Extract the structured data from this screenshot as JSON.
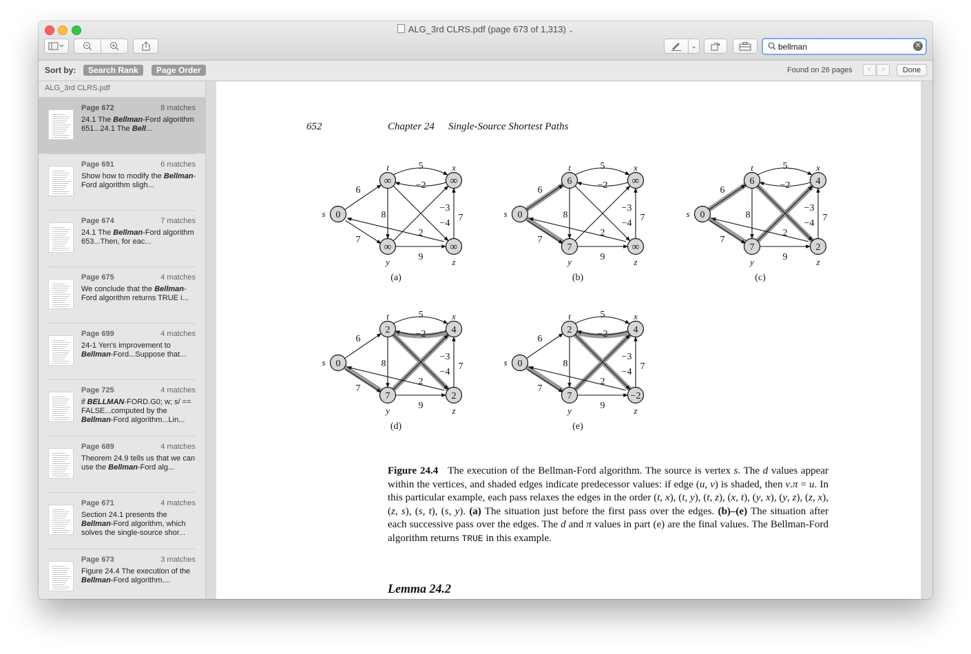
{
  "window": {
    "title": "ALG_3rd CLRS.pdf (page 673 of 1,313)",
    "search_value": "bellman"
  },
  "sortbar": {
    "label": "Sort by:",
    "search_rank": "Search Rank",
    "page_order": "Page Order",
    "found": "Found on 26 pages",
    "done": "Done"
  },
  "sidebar": {
    "filename": "ALG_3rd CLRS.pdf",
    "results": [
      {
        "page": "Page 672",
        "matches": "8 matches",
        "snippet_html": "24.1 The <b><i>Bellman</i></b>-Ford algorithm 651...24.1 The <b><i>Bell</i></b>..."
      },
      {
        "page": "Page 691",
        "matches": "6 matches",
        "snippet_html": "Show how to modify the <b><i>Bellman</i></b>-Ford algorithm sligh..."
      },
      {
        "page": "Page 674",
        "matches": "7 matches",
        "snippet_html": "24.1 The <b><i>Bellman</i></b>-Ford algorithm 653...Then, for eac..."
      },
      {
        "page": "Page 675",
        "matches": "4 matches",
        "snippet_html": "We conclude that the <b><i>Bellman</i></b>-Ford algorithm returns TRUE i..."
      },
      {
        "page": "Page 699",
        "matches": "4 matches",
        "snippet_html": "24-1 Yen's improvement to <b><i>Bellman</i></b>-Ford...Suppose that..."
      },
      {
        "page": "Page 725",
        "matches": "4 matches",
        "snippet_html": "if <b><i>BELLMAN</i></b>-FORD.G0; w; s/ == FALSE...computed by the <b><i>Bellman</i></b>-Ford algorithm...Lin..."
      },
      {
        "page": "Page 689",
        "matches": "4 matches",
        "snippet_html": "Theorem 24.9 tells us that we can use the <b><i>Bellman</i></b>-Ford alg..."
      },
      {
        "page": "Page 671",
        "matches": "4 matches",
        "snippet_html": "Section 24.1 presents the <b><i>Bellman</i></b>-Ford algorithm, which solves the single-source shor..."
      },
      {
        "page": "Page 673",
        "matches": "3 matches",
        "snippet_html": "Figure 24.4 The execution of the <b><i>Bellman</i></b>-Ford algorithm...."
      }
    ]
  },
  "page": {
    "number": "652",
    "chapter": "Chapter 24",
    "chapter_title": "Single-Source Shortest Paths",
    "lemma": "Lemma 24.2",
    "caption_html": "<b>Figure 24.4</b>&nbsp;&nbsp; The execution of the Bellman-Ford algorithm. The source is vertex <i>s</i>. The <i>d</i> values appear within the vertices, and shaded edges indicate predecessor values: if edge (<i>u</i>, <i>v</i>) is shaded, then <i>v</i>.<i>π</i> = <i>u</i>. In this particular example, each pass relaxes the edges in the order (<i>t</i>, <i>x</i>), (<i>t</i>, <i>y</i>), (<i>t</i>, <i>z</i>), (<i>x</i>, <i>t</i>), (<i>y</i>, <i>x</i>), (<i>y</i>, <i>z</i>), (<i>z</i>, <i>x</i>), (<i>z</i>, <i>s</i>), (<i>s</i>, <i>t</i>), (<i>s</i>, <i>y</i>). <b>(a)</b> The situation just before the first pass over the edges. <b>(b)–(e)</b> The situation after each successive pass over the edges. The <i>d</i> and <i>π</i> values in part (e) are the final values. The Bellman-Ford algorithm returns <span style=\"font-family:'Liberation Mono',monospace;font-size:13px\">TRUE</span> in this example."
  },
  "figure": {
    "vertex_names": {
      "s": "s",
      "t": "t",
      "x": "x",
      "y": "y",
      "z": "z"
    },
    "edges": [
      {
        "from": "s",
        "to": "t",
        "w": "6"
      },
      {
        "from": "s",
        "to": "y",
        "w": "7"
      },
      {
        "from": "t",
        "to": "x",
        "w": "5"
      },
      {
        "from": "x",
        "to": "t",
        "w": "−2"
      },
      {
        "from": "t",
        "to": "y",
        "w": "8"
      },
      {
        "from": "t",
        "to": "z",
        "w": "−4"
      },
      {
        "from": "y",
        "to": "x",
        "w": "−3"
      },
      {
        "from": "y",
        "to": "z",
        "w": "9"
      },
      {
        "from": "z",
        "to": "x",
        "w": "7"
      },
      {
        "from": "z",
        "to": "s",
        "w": "2"
      }
    ],
    "panels": [
      {
        "label": "(a)",
        "d": {
          "s": "0",
          "t": "∞",
          "x": "∞",
          "y": "∞",
          "z": "∞"
        },
        "shaded": []
      },
      {
        "label": "(b)",
        "d": {
          "s": "0",
          "t": "6",
          "x": "∞",
          "y": "7",
          "z": "∞"
        },
        "shaded": [
          "s-t",
          "s-y"
        ]
      },
      {
        "label": "(c)",
        "d": {
          "s": "0",
          "t": "6",
          "x": "4",
          "y": "7",
          "z": "2"
        },
        "shaded": [
          "s-t",
          "s-y",
          "y-x",
          "t-z"
        ]
      },
      {
        "label": "(d)",
        "d": {
          "s": "0",
          "t": "2",
          "x": "4",
          "y": "7",
          "z": "2"
        },
        "shaded": [
          "s-y",
          "y-x",
          "x-t",
          "t-z"
        ]
      },
      {
        "label": "(e)",
        "d": {
          "s": "0",
          "t": "2",
          "x": "4",
          "y": "7",
          "z": "−2"
        },
        "shaded": [
          "s-y",
          "y-x",
          "x-t",
          "t-z"
        ]
      }
    ]
  }
}
